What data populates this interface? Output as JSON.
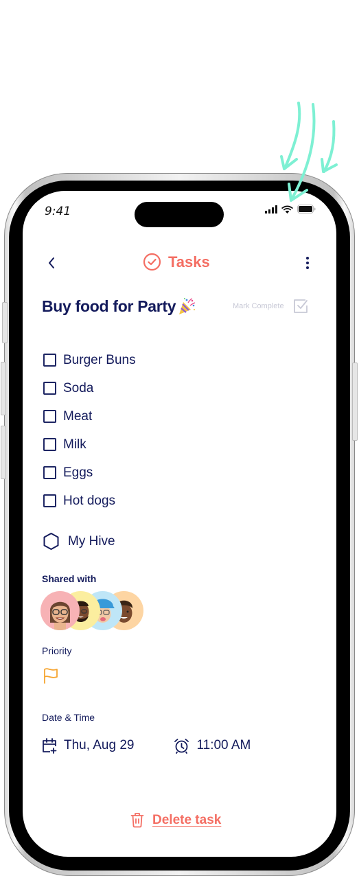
{
  "status_bar": {
    "time": "9:41",
    "icons": [
      "cellular-signal-icon",
      "wifi-icon",
      "battery-icon"
    ]
  },
  "header": {
    "back_icon": "chevron-left-icon",
    "title": "Tasks",
    "title_icon": "check-circle-icon",
    "menu_icon": "more-vertical-icon"
  },
  "task": {
    "title": "Buy food for Party",
    "title_emoji": "🎉",
    "mark_complete_label": "Mark Complete"
  },
  "checklist": [
    {
      "label": "Burger Buns",
      "checked": false
    },
    {
      "label": "Soda",
      "checked": false
    },
    {
      "label": "Meat",
      "checked": false
    },
    {
      "label": "Milk",
      "checked": false
    },
    {
      "label": "Eggs",
      "checked": false
    },
    {
      "label": "Hot dogs",
      "checked": false
    }
  ],
  "hive": {
    "icon": "hexagon-icon",
    "label": "My Hive"
  },
  "shared": {
    "label": "Shared with",
    "avatars": [
      {
        "name": "avatar-1",
        "bg": "#f7b2b5"
      },
      {
        "name": "avatar-2",
        "bg": "#fbee9f"
      },
      {
        "name": "avatar-3",
        "bg": "#bfe6f7"
      },
      {
        "name": "avatar-4",
        "bg": "#fdd5a3"
      }
    ]
  },
  "priority": {
    "label": "Priority",
    "icon": "flag-icon",
    "color": "#f6a531"
  },
  "datetime": {
    "label": "Date & Time",
    "date": "Thu, Aug 29",
    "time": "11:00 AM"
  },
  "delete": {
    "label": "Delete task"
  },
  "colors": {
    "accent": "#f46e63",
    "text": "#141b5c",
    "muted": "#c8c9d6",
    "annotation": "#7ef0d3"
  }
}
